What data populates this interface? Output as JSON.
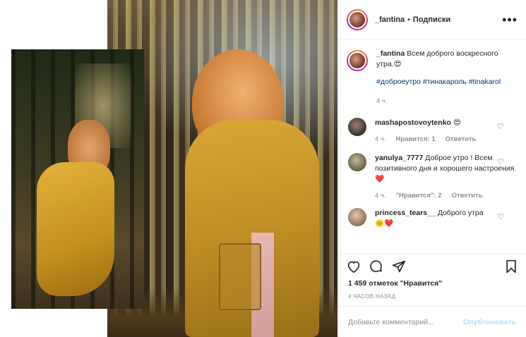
{
  "post": {
    "author": "_fantina",
    "separator": "•",
    "follow_label": "Подписки",
    "more_label": "•••"
  },
  "caption": {
    "username": "_fantina",
    "text": "Всем доброго воскресного утра.",
    "emoji": "😍",
    "hashtags": [
      "#доброеутро",
      "#тинакароль",
      "#tinakarol"
    ],
    "time": "4 ч."
  },
  "comments": [
    {
      "username": "mashapostovoytenko",
      "text": "😍",
      "time": "4 ч.",
      "likes": "Нравится: 1",
      "reply": "Ответить"
    },
    {
      "username": "yanulya_7777",
      "text": "Доброе утро ! Всем позитивного дня и хорошего настроения.",
      "emoji": "❤️",
      "time": "4 ч.",
      "likes": "\"Нравится\": 2",
      "reply": "Ответить"
    },
    {
      "username": "princess_tears__",
      "text": "Доброго утра",
      "emoji": "🌞❤️"
    }
  ],
  "icons": {
    "like": "heart-icon",
    "comment": "comment-icon",
    "share": "share-icon",
    "save": "bookmark-icon"
  },
  "likes_text": "1 459 отметок \"Нравится\"",
  "time_ago": "4 ЧАСОВ НАЗАД",
  "add_comment": {
    "placeholder": "Добавьте комментарий...",
    "publish_label": "Опубликовать"
  }
}
